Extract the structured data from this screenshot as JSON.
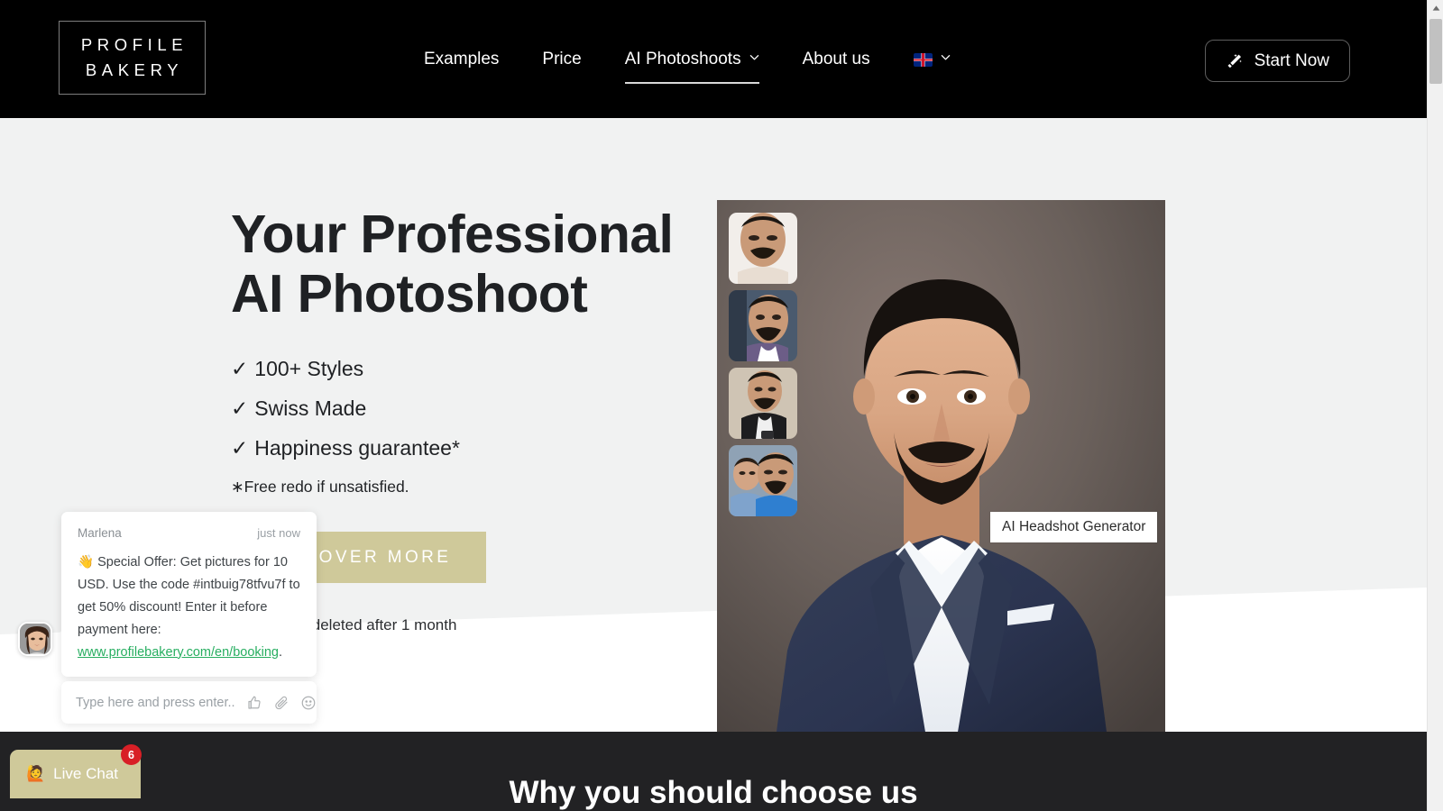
{
  "brand": {
    "logo_line1": "PROFILE",
    "logo_line2": "BAKERY"
  },
  "header": {
    "nav": [
      {
        "label": "Examples",
        "icon": "",
        "active": false
      },
      {
        "label": "Price",
        "icon": "",
        "active": false
      },
      {
        "label": "AI Photoshoots",
        "icon": "chevron-down-icon",
        "active": true
      },
      {
        "label": "About us",
        "icon": "",
        "active": false
      }
    ],
    "language": {
      "flag": "uk-flag-icon",
      "icon": "chevron-down-icon"
    },
    "cta": {
      "label": "Start Now",
      "icon": "magic-wand-icon"
    }
  },
  "hero": {
    "headline_line1": "Your Professional",
    "headline_line2": "AI Photoshoot",
    "bullets": [
      {
        "tick": "✓",
        "label": "100+ Styles"
      },
      {
        "tick": "✓",
        "label": "Swiss Made"
      },
      {
        "tick": "✓",
        "label": "Happiness guarantee*"
      }
    ],
    "footnote": "∗Free redo if unsatisfied.",
    "cta_label": "DISCOVER MORE",
    "deleted_note": "Images are deleted after 1 month",
    "image_label": "AI Headshot Generator",
    "thumbnails": [
      {
        "name": "selfie-thumbnail-1"
      },
      {
        "name": "selfie-thumbnail-2"
      },
      {
        "name": "selfie-thumbnail-3"
      },
      {
        "name": "selfie-thumbnail-4"
      }
    ]
  },
  "next_section": {
    "title": "Why you should choose us"
  },
  "chat": {
    "agent_name": "Marlena",
    "timestamp": "just now",
    "message_emoji": "👋",
    "message_text": " Special Offer: Get pictures for 10 USD. Use the code #intbuig78tfvu7f to get 50% discount! Enter it before payment here: ",
    "link_text": "www.profilebakery.com/en/booking",
    "message_suffix": ".",
    "input_placeholder": "Type here and press enter..",
    "icons": [
      {
        "name": "thumbs-up-icon"
      },
      {
        "name": "paperclip-icon"
      },
      {
        "name": "emoji-smiley-icon"
      }
    ],
    "launcher_label": "Live Chat",
    "launcher_emoji": "🙋",
    "unread_count": "6"
  },
  "colors": {
    "header_bg": "#000000",
    "page_bg": "#f1f2f2",
    "accent_khaki": "#cfc99a",
    "dark_section": "#222224",
    "link_green": "#27ae60",
    "badge_red": "#d81f26",
    "text_dark": "#1f2124"
  }
}
